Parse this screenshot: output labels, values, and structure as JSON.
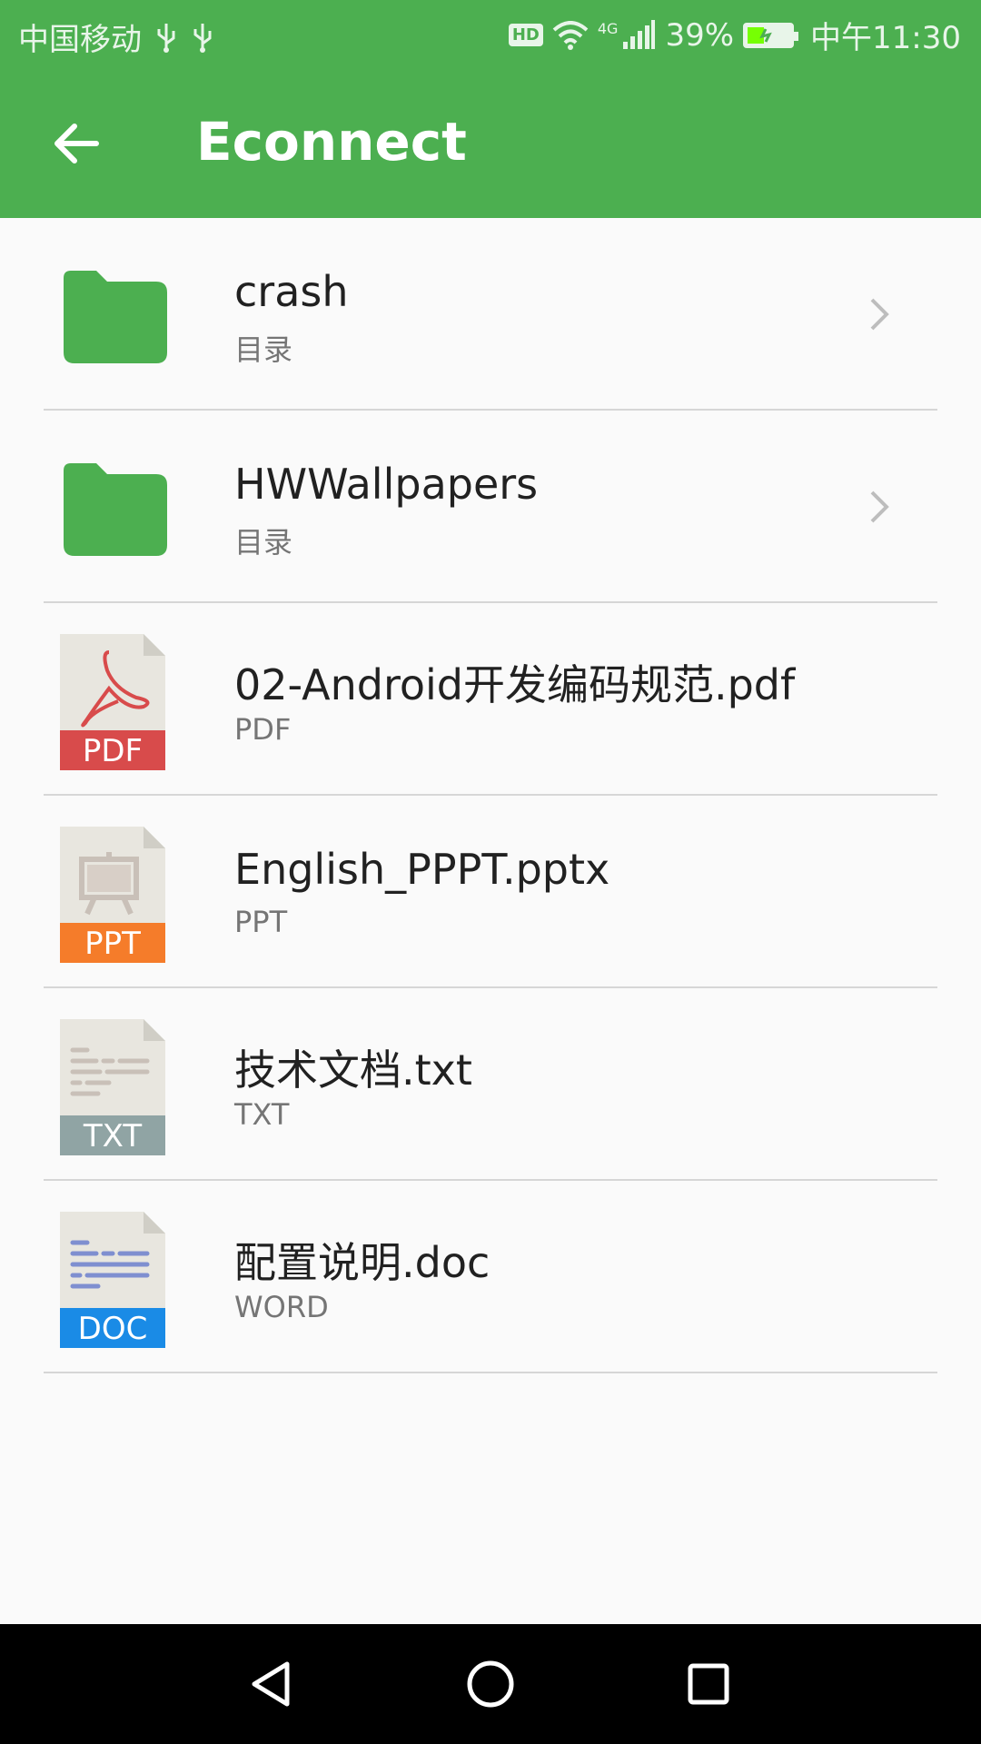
{
  "status_bar": {
    "carrier": "中国移动",
    "hd": "HD",
    "network": "4G",
    "battery_percent": "39%",
    "battery_level": 0.39,
    "time": "中午11:30"
  },
  "app_bar": {
    "title": "Econnect",
    "back_icon": "arrow-back-icon"
  },
  "files": [
    {
      "name": "crash",
      "type": "目录",
      "icon": "folder-icon",
      "has_chevron": true
    },
    {
      "name": "HWWallpapers",
      "type": "目录",
      "icon": "folder-icon",
      "has_chevron": true
    },
    {
      "name": "02-Android开发编码规范.pdf",
      "type": "PDF",
      "icon": "pdf-file-icon",
      "badge": "PDF",
      "badge_color": "#d84b4b"
    },
    {
      "name": "English_PPPT.pptx",
      "type": "PPT",
      "icon": "ppt-file-icon",
      "badge": "PPT",
      "badge_color": "#f57c2a"
    },
    {
      "name": "技术文档.txt",
      "type": "TXT",
      "icon": "txt-file-icon",
      "badge": "TXT",
      "badge_color": "#90a4a4"
    },
    {
      "name": "配置说明.doc",
      "type": "WORD",
      "icon": "doc-file-icon",
      "badge": "DOC",
      "badge_color": "#1a8be6"
    }
  ],
  "colors": {
    "primary": "#4caf50",
    "folder": "#4caf50"
  },
  "nav_bar": {
    "back": "nav-back-icon",
    "home": "nav-home-icon",
    "recents": "nav-recents-icon"
  }
}
